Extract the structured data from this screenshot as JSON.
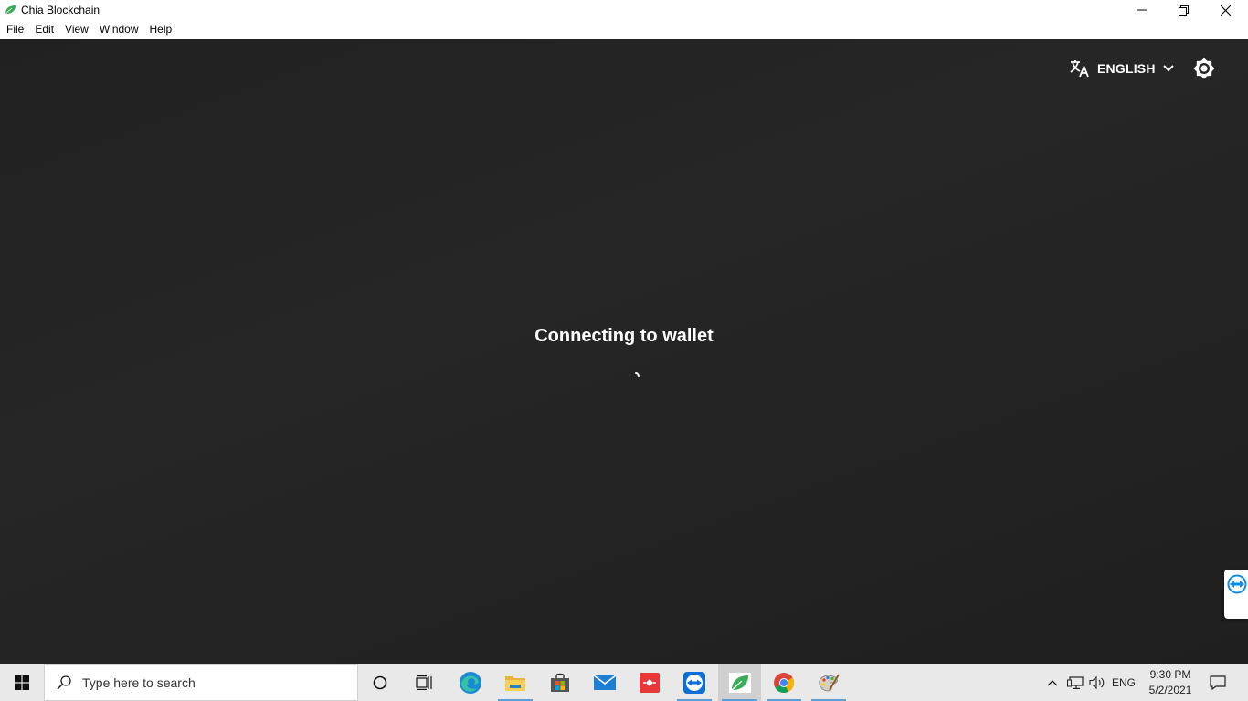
{
  "window": {
    "title": "Chia Blockchain",
    "brand_color": "#3aac59"
  },
  "menu": {
    "items": [
      "File",
      "Edit",
      "View",
      "Window",
      "Help"
    ]
  },
  "toolbar": {
    "language_label": "ENGLISH"
  },
  "main": {
    "status_text": "Connecting to wallet"
  },
  "taskbar": {
    "search_placeholder": "Type here to search",
    "tray_language": "ENG",
    "time": "9:30 PM",
    "date": "5/2/2021",
    "apps": [
      "cortana-icon",
      "task-view-icon",
      "edge-icon",
      "file-explorer-icon",
      "store-icon",
      "mail-icon",
      "git-app-icon",
      "teamviewer-icon",
      "chia-icon",
      "chrome-icon",
      "paint-icon"
    ]
  }
}
